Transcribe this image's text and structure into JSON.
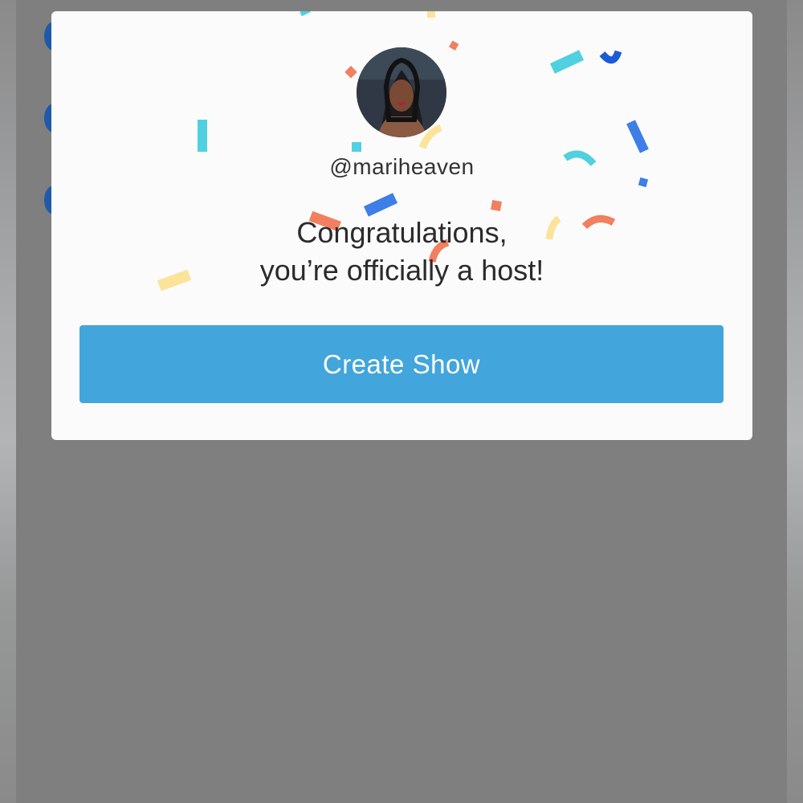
{
  "modal": {
    "username": "@mariheaven",
    "title_line1": "Congratulations,",
    "title_line2": "you’re officially a host!",
    "create_show_label": "Create Show",
    "avatar_icon": "user-avatar-photo"
  },
  "colors": {
    "button": "#42a5db",
    "overlay": "#7f7f7f",
    "modal_bg": "#fcfbfc",
    "confetti": [
      "#4fd1e0",
      "#f08060",
      "#3d7fe6",
      "#fbe39a",
      "#1a5bd8"
    ]
  }
}
